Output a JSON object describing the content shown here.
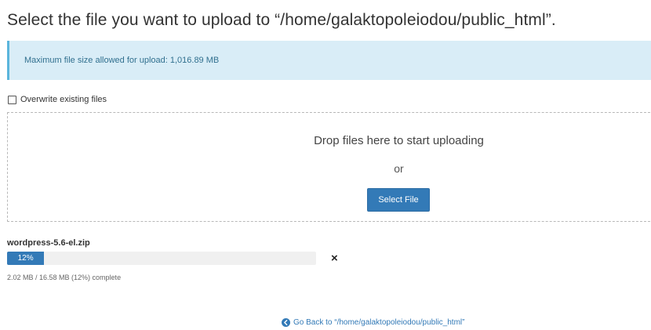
{
  "heading": "Select the file you want to upload to “/home/galaktopoleiodou/public_html”.",
  "info": {
    "text": "Maximum file size allowed for upload: 1,016.89 MB"
  },
  "overwrite": {
    "label": "Overwrite existing files",
    "checked": false
  },
  "dropzone": {
    "prompt": "Drop files here to start uploading",
    "or": "or",
    "select_button": "Select File"
  },
  "upload": {
    "filename": "wordpress-5.6-el.zip",
    "progress_percent": 12,
    "progress_label": "12%",
    "status": "2.02 MB / 16.58 MB (12%) complete",
    "cancel_symbol": "×"
  },
  "footer": {
    "go_back": "Go Back to “/home/galaktopoleiodou/public_html”",
    "go_back_icon": "circle-arrow-left-icon"
  },
  "colors": {
    "accent": "#337ab7",
    "info_bg": "#d9edf7",
    "info_border": "#5bb5dc"
  }
}
